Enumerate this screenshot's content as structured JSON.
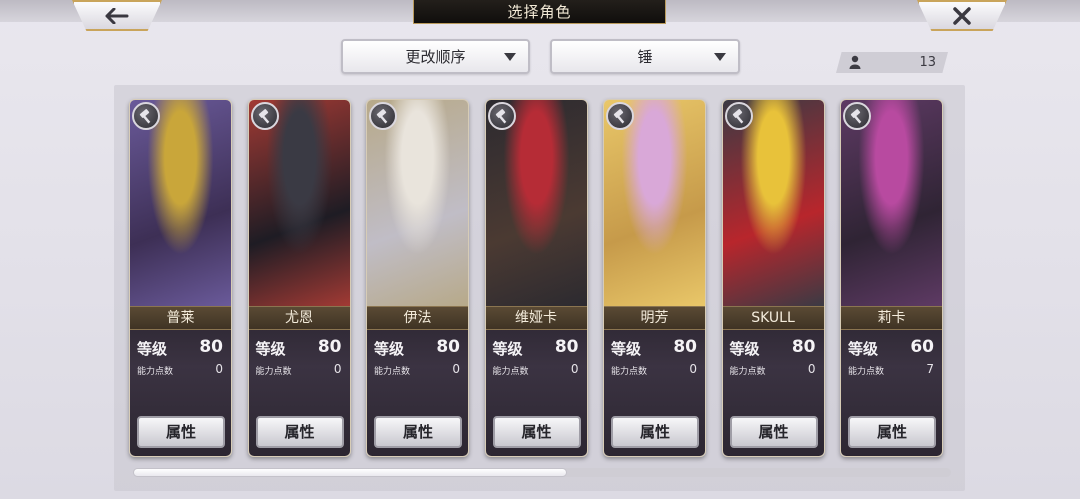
{
  "header": {
    "title": "选择角色",
    "back_icon": "arrow-left-icon",
    "close_icon": "close-x-icon"
  },
  "filters": {
    "sort_label": "更改顺序",
    "weapon_label": "锤"
  },
  "character_count": "13",
  "cards": [
    {
      "name": "普莱",
      "level_label": "等级",
      "level": "80",
      "ap_label": "能力点数",
      "ap": "0",
      "button": "属性",
      "colors": [
        "#c9a63a",
        "#6a5a9a",
        "#3d2f55"
      ]
    },
    {
      "name": "尤恩",
      "level_label": "等级",
      "level": "80",
      "ap_label": "能力点数",
      "ap": "0",
      "button": "属性",
      "colors": [
        "#3a3a44",
        "#a23a34",
        "#1e1c24"
      ]
    },
    {
      "name": "伊法",
      "level_label": "等级",
      "level": "80",
      "ap_label": "能力点数",
      "ap": "0",
      "button": "属性",
      "colors": [
        "#e9e4dc",
        "#b7a989",
        "#c0bdc6"
      ]
    },
    {
      "name": "维娅卡",
      "level_label": "等级",
      "level": "80",
      "ap_label": "能力点数",
      "ap": "0",
      "button": "属性",
      "colors": [
        "#b62c36",
        "#2c2a30",
        "#4b3a32"
      ]
    },
    {
      "name": "明芳",
      "level_label": "等级",
      "level": "80",
      "ap_label": "能力点数",
      "ap": "0",
      "button": "属性",
      "colors": [
        "#d9a8d8",
        "#e9c769",
        "#c69a4a"
      ]
    },
    {
      "name": "SKULL",
      "level_label": "等级",
      "level": "80",
      "ap_label": "能力点数",
      "ap": "0",
      "button": "属性",
      "colors": [
        "#e8c23a",
        "#3b3a44",
        "#b8262c"
      ]
    },
    {
      "name": "莉卡",
      "level_label": "等级",
      "level": "60",
      "ap_label": "能力点数",
      "ap": "7",
      "button": "属性",
      "colors": [
        "#b84aa0",
        "#5e3a64",
        "#2f2434"
      ]
    }
  ],
  "scroll": {
    "position": 0.53
  }
}
